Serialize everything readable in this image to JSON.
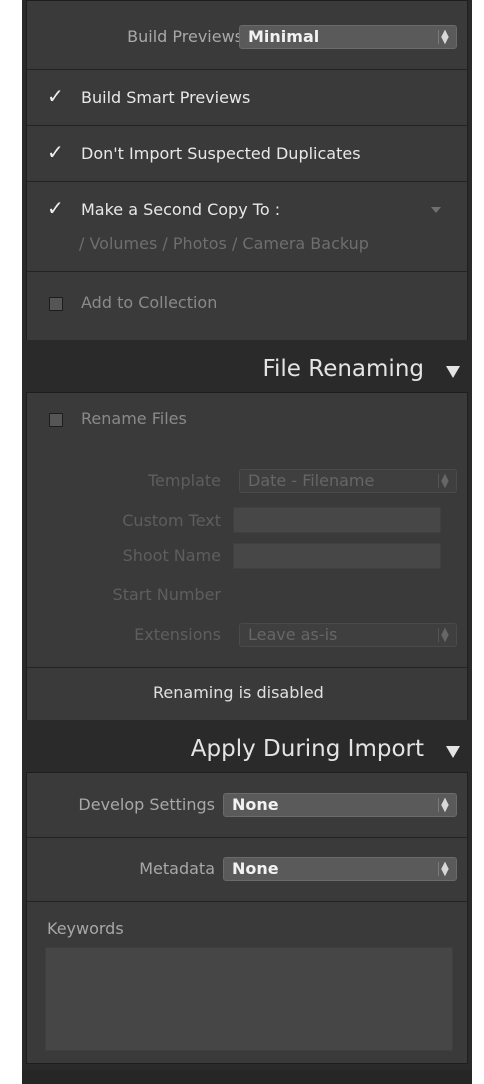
{
  "top": {
    "build_previews_label": "Build Previews",
    "build_previews_value": "Minimal",
    "build_smart_previews": {
      "label": "Build Smart Previews",
      "checked": true
    },
    "dont_import_duplicates": {
      "label": "Don't Import Suspected Duplicates",
      "checked": true
    },
    "second_copy": {
      "label": "Make a Second Copy To :",
      "checked": true,
      "path": "/ Volumes / Photos / Camera Backup"
    },
    "add_to_collection": {
      "label": "Add to Collection",
      "checked": false
    }
  },
  "file_renaming": {
    "title": "File Renaming",
    "rename_files": {
      "label": "Rename Files",
      "checked": false
    },
    "template_label": "Template",
    "template_value": "Date - Filename",
    "custom_text_label": "Custom Text",
    "custom_text_value": "",
    "shoot_name_label": "Shoot Name",
    "shoot_name_value": "",
    "start_number_label": "Start Number",
    "extensions_label": "Extensions",
    "extensions_value": "Leave as-is",
    "status": "Renaming is disabled"
  },
  "apply_during_import": {
    "title": "Apply During Import",
    "develop_settings_label": "Develop Settings",
    "develop_settings_value": "None",
    "metadata_label": "Metadata",
    "metadata_value": "None",
    "keywords_label": "Keywords",
    "keywords_value": ""
  },
  "colors": {
    "panel_bg": "#2a2a2a",
    "section_bg": "#3a3a3a",
    "header_text": "#e4e4e4",
    "disabled_text": "#6e6e6e"
  },
  "icons": {
    "checked": "checkmark-icon",
    "unchecked": "empty-checkbox-icon",
    "collapse": "triangle-down-icon",
    "select": "updown-arrows-icon"
  }
}
